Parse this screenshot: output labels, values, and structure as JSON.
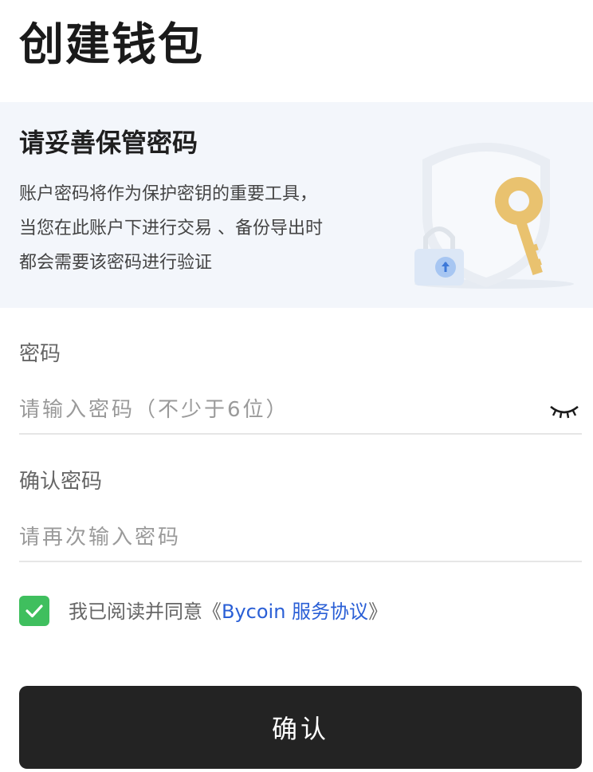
{
  "page": {
    "title": "创建钱包"
  },
  "notice": {
    "title": "请妥善保管密码",
    "lines": [
      "账户密码将作为保护密钥的重要工具，",
      "当您在此账户下进行交易 、备份导出时",
      "都会需要该密码进行验证"
    ],
    "illustration_icon": "shield-key-lock-illustration"
  },
  "password": {
    "label": "密码",
    "placeholder": "请输入密码（不少于6位）",
    "value": "",
    "toggle_icon": "eye-closed-icon"
  },
  "confirm_password": {
    "label": "确认密码",
    "placeholder": "请再次输入密码",
    "value": ""
  },
  "agreement": {
    "checked": true,
    "prefix": "我已阅读并同意《",
    "link": "Bycoin 服务协议",
    "suffix": "》"
  },
  "confirm_button": {
    "label": "确认"
  },
  "colors": {
    "check_green": "#3fbf5e",
    "link_blue": "#2a5fd6",
    "button_dark": "#232323",
    "notice_bg": "#f3f6fb"
  }
}
